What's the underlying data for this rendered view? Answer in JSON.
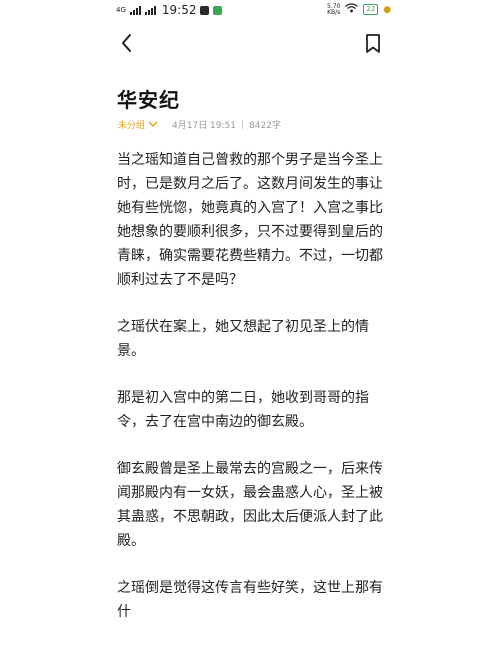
{
  "status_bar": {
    "network": "4G",
    "time": "19:52",
    "speed": "5.70",
    "speed_unit": "KB/s",
    "battery": "22"
  },
  "article": {
    "title": "华安纪",
    "category": "未分组",
    "date": "4月17日 19:51",
    "separator": "|",
    "word_count": "8422字",
    "paragraphs": [
      "当之瑶知道自己曾救的那个男子是当今圣上时，已是数月之后了。这数月间发生的事让她有些恍惚，她竟真的入宫了！入宫之事比她想象的要顺利很多，只不过要得到皇后的青睐，确实需要花费些精力。不过，一切都顺利过去了不是吗？",
      "之瑶伏在案上，她又想起了初见圣上的情景。",
      "那是初入宫中的第二日，她收到哥哥的指令，去了在宫中南边的御玄殿。",
      "御玄殿曾是圣上最常去的宫殿之一，后来传闻那殿内有一女妖，最会蛊惑人心，圣上被其蛊惑，不思朝政，因此太后便派人封了此殿。",
      "之瑶倒是觉得这传言有些好笑，这世上那有什"
    ]
  }
}
